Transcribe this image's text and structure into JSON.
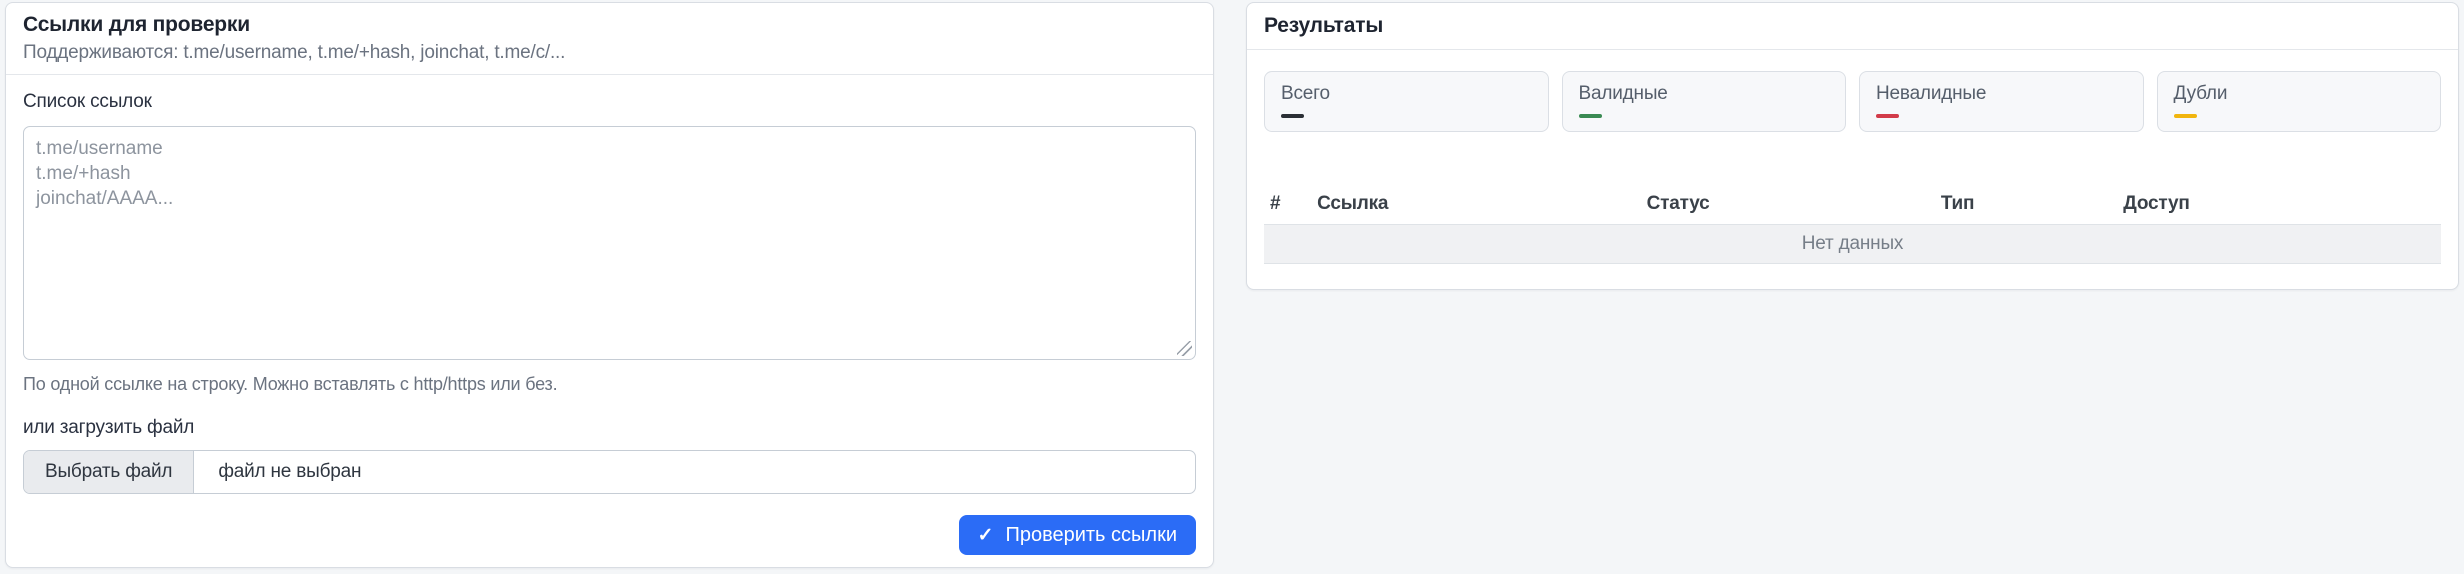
{
  "left_panel": {
    "title": "Ссылки для проверки",
    "subtitle": "Поддерживаются: t.me/username, t.me/+hash, joinchat, t.me/c/...",
    "links_label": "Список ссылок",
    "textarea_placeholder": "t.me/username\nt.me/+hash\njoinchat/AAAA...",
    "textarea_hint": "По одной ссылке на строку. Можно вставлять с http/https или без.",
    "upload_label": "или загрузить файл",
    "file_button_label": "Выбрать файл",
    "file_status": "файл не выбран",
    "submit_icon": "✓",
    "submit_label": "Проверить ссылки",
    "submit_color": "#2b6cf6"
  },
  "results_panel": {
    "title": "Результаты",
    "stats": [
      {
        "label": "Всего",
        "color": "#2b2f35"
      },
      {
        "label": "Валидные",
        "color": "#3a8a53"
      },
      {
        "label": "Невалидные",
        "color": "#d23b49"
      },
      {
        "label": "Дубли",
        "color": "#f1b50e"
      }
    ],
    "table": {
      "columns": [
        "#",
        "Ссылка",
        "Статус",
        "Тип",
        "Доступ"
      ],
      "empty_text": "Нет данных"
    }
  }
}
